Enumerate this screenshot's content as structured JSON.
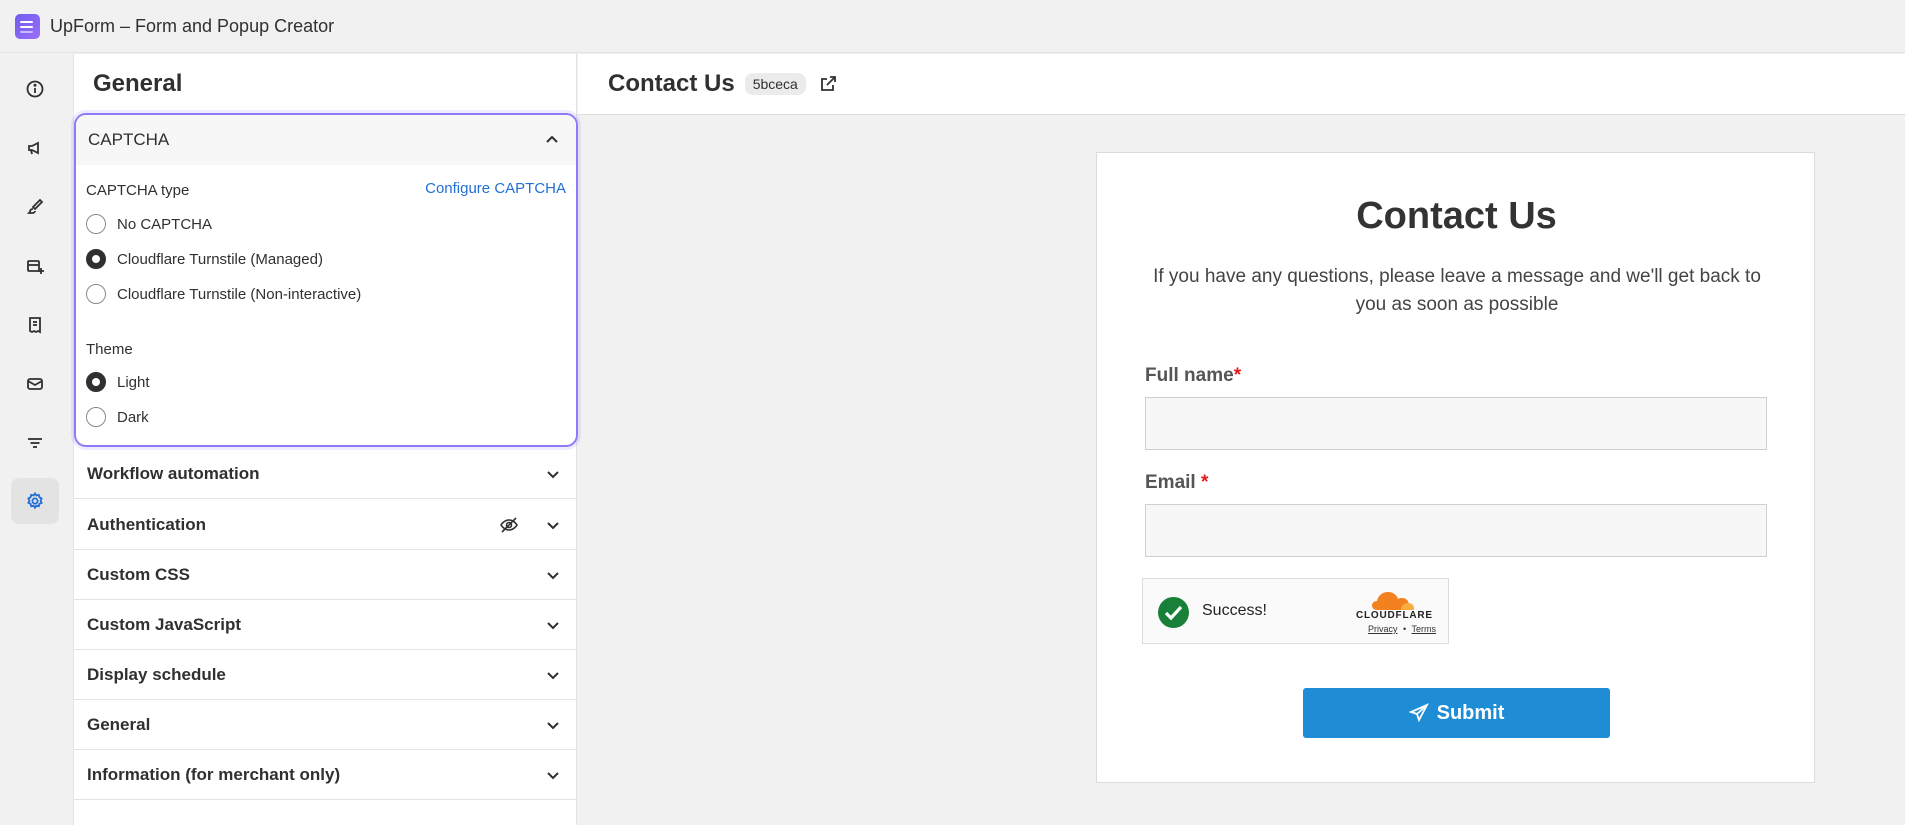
{
  "app": {
    "title": "UpForm – Form and Popup Creator"
  },
  "panel": {
    "title": "General",
    "captcha": {
      "header": "CAPTCHA",
      "type_label": "CAPTCHA type",
      "configure_link": "Configure CAPTCHA",
      "type_options": [
        {
          "label": "No CAPTCHA",
          "selected": false
        },
        {
          "label": "Cloudflare Turnstile (Managed)",
          "selected": true
        },
        {
          "label": "Cloudflare Turnstile (Non-interactive)",
          "selected": false
        }
      ],
      "theme_label": "Theme",
      "theme_options": [
        {
          "label": "Light",
          "selected": true
        },
        {
          "label": "Dark",
          "selected": false
        }
      ]
    },
    "sections": [
      "Workflow automation",
      "Authentication",
      "Custom CSS",
      "Custom JavaScript",
      "Display schedule",
      "General",
      "Information (for merchant only)"
    ]
  },
  "main": {
    "title": "Contact Us",
    "form_id": "5bceca"
  },
  "form": {
    "title": "Contact Us",
    "description": "If you have any questions, please leave a message and we'll get back to you as soon as possible",
    "fields": [
      {
        "label": "Full name",
        "required_mark": "*"
      },
      {
        "label": "Email ",
        "required_mark": "*"
      }
    ],
    "turnstile": {
      "status": "Success!",
      "brand": "CLOUDFLARE",
      "privacy": "Privacy",
      "separator": "•",
      "terms": "Terms"
    },
    "submit_label": "Submit"
  },
  "colors": {
    "accent": "#8c7bf5",
    "link": "#1f6fd6",
    "submit": "#1f8dd6",
    "success": "#188038",
    "required": "#e01b1b"
  }
}
